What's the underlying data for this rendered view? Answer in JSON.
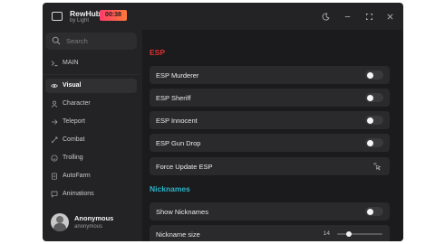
{
  "header": {
    "title": "RewHub",
    "subtitle": "by Light",
    "timer": "00:38",
    "icons": [
      "window-icon",
      "moon-icon",
      "minimize-icon",
      "maximize-icon",
      "close-icon"
    ]
  },
  "sidebar": {
    "search_placeholder": "Search",
    "items": [
      {
        "label": "MAIN",
        "icon": "terminal-icon",
        "active": false
      },
      {
        "label": "Visual",
        "icon": "eye-icon",
        "active": true
      },
      {
        "label": "Character",
        "icon": "user-icon",
        "active": false
      },
      {
        "label": "Teleport",
        "icon": "arrow-right-icon",
        "active": false
      },
      {
        "label": "Combat",
        "icon": "sword-icon",
        "active": false
      },
      {
        "label": "Trolling",
        "icon": "smile-icon",
        "active": false
      },
      {
        "label": "AutoFarm",
        "icon": "document-icon",
        "active": false
      },
      {
        "label": "Animations",
        "icon": "speech-bubble-icon",
        "active": false
      }
    ]
  },
  "profile": {
    "name": "Anonymous",
    "handle": "anonymous"
  },
  "main": {
    "sections": [
      {
        "title": "ESP",
        "color": "#e03030"
      },
      {
        "title": "Nicknames",
        "color": "#2bb3c7"
      }
    ],
    "esp_rows": [
      {
        "label": "ESP Murderer",
        "type": "toggle",
        "on": false
      },
      {
        "label": "ESP Sheriff",
        "type": "toggle",
        "on": false
      },
      {
        "label": "ESP Innocent",
        "type": "toggle",
        "on": false
      },
      {
        "label": "ESP Gun Drop",
        "type": "toggle",
        "on": false
      },
      {
        "label": "Force Update ESP",
        "type": "button"
      }
    ],
    "nick_rows": [
      {
        "label": "Show Nicknames",
        "type": "toggle",
        "on": false
      },
      {
        "label": "Nickname size",
        "type": "slider",
        "value": "14",
        "fraction": 0.25
      }
    ]
  },
  "colors": {
    "accent_timer_start": "#ff3d6c",
    "accent_timer_end": "#ff7a38",
    "background": "#232325",
    "panel": "#1b1b1d"
  }
}
